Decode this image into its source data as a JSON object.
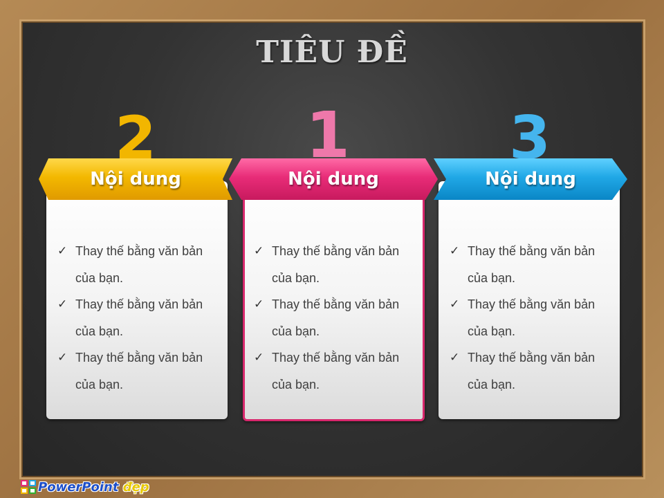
{
  "title": "TIÊU ĐỀ",
  "columns": [
    {
      "rank": "2",
      "heading": "Nội dung",
      "color": "#f3b800",
      "items": [
        "Thay thế bằng văn bản của bạn.",
        "Thay thế bằng văn bản của bạn.",
        "Thay thế bằng văn bản của bạn."
      ]
    },
    {
      "rank": "1",
      "heading": "Nội dung",
      "color": "#e82c78",
      "items": [
        "Thay thế bằng văn bản của bạn.",
        "Thay thế bằng văn bản của bạn.",
        "Thay thế bằng văn bản của bạn."
      ]
    },
    {
      "rank": "3",
      "heading": "Nội dung",
      "color": "#20a8e6",
      "items": [
        "Thay thế bằng văn bản của bạn.",
        "Thay thế bằng văn bản của bạn.",
        "Thay thế bằng văn bản của bạn."
      ]
    }
  ],
  "logo": {
    "text_main": "PowerPoint",
    "text_accent": "đẹp",
    "icon": "powerpoint-logo-icon"
  },
  "check_icon": "checkmark-icon"
}
